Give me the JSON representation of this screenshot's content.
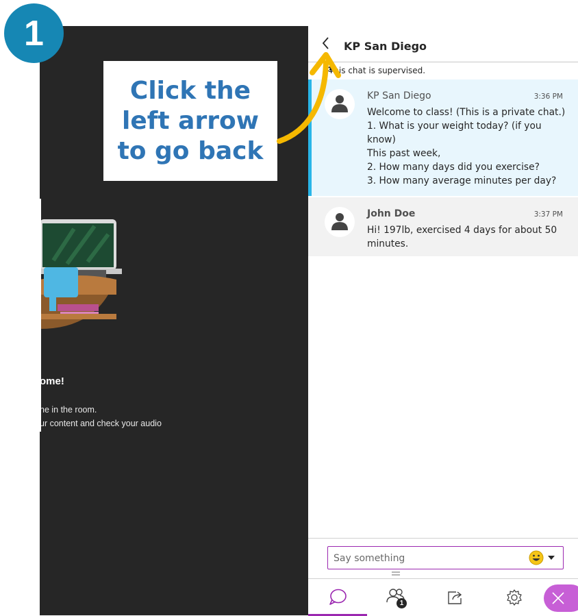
{
  "step": {
    "number": "1"
  },
  "callout": {
    "line1": "Click the",
    "line2": "left arrow",
    "line3": "to go back"
  },
  "stage": {
    "welcome": "ome!",
    "line1": "ne in the room.",
    "line2": "ur content and check your audio"
  },
  "chat": {
    "title": "KP San Diego",
    "supervised": "This chat is supervised.",
    "messages": [
      {
        "author": "KP San Diego",
        "time": "3:36 PM",
        "lines": [
          "Welcome to class! (This is a private chat.)",
          "1. What is your weight today? (if you",
          "know)",
          "This past week,",
          "2. How many days did you exercise?",
          "3. How many average minutes per day?"
        ]
      },
      {
        "author": "John Doe",
        "time": "3:37 PM",
        "lines": [
          "Hi! 197lb, exercised 4 days for about 50",
          "minutes."
        ]
      }
    ],
    "compose_placeholder": "Say something"
  },
  "tabbar": {
    "people_count": "1"
  },
  "colors": {
    "accent": "#9b27b0",
    "highlight": "#29b5e8",
    "callout_text": "#2f75b5",
    "arrow": "#f5b800",
    "step_badge": "#1687b4"
  },
  "icons": [
    "chevron-left-icon",
    "eye-icon",
    "user-avatar-icon",
    "emoji-icon",
    "chat-icon",
    "people-icon",
    "share-icon",
    "gear-icon",
    "close-icon"
  ]
}
